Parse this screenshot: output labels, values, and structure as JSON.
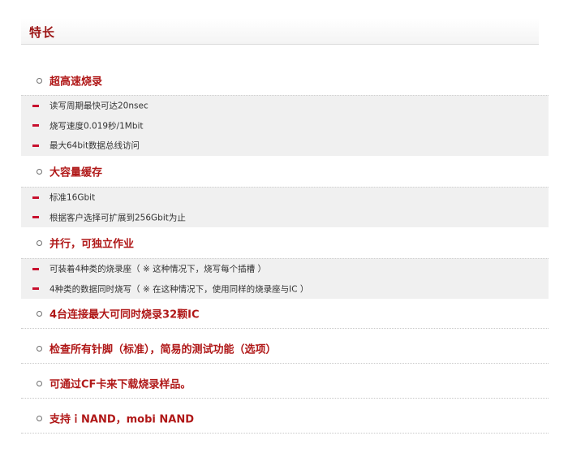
{
  "header": {
    "title": "特长"
  },
  "sections": [
    {
      "title": "超高速烧录",
      "items": [
        "读写周期最快可达20nsec",
        "烧写速度0.019秒/1Mbit",
        "最大64bit数据总线访问"
      ]
    },
    {
      "title": "大容量缓存",
      "items": [
        "标准16Gbit",
        "根据客户选择可扩展到256Gbit为止"
      ]
    },
    {
      "title": "并行，可独立作业",
      "items": [
        "可装着4种类的烧录座（ ※ 这种情况下，烧写每个插槽 ）",
        "4种类的数据同时烧写（ ※ 在这种情况下，使用同样的烧录座与IC ）"
      ]
    },
    {
      "title": "4台连接最大可同时烧录32颗IC",
      "items": []
    },
    {
      "title": "检查所有针脚（标准），简易的测试功能（选项）",
      "items": []
    },
    {
      "title": "可通过CF卡来下载烧录样品。",
      "items": []
    },
    {
      "title": "支持ｉNAND，mobi NAND",
      "items": []
    }
  ],
  "colors": {
    "accent": "#b01818",
    "dash": "#c8102e",
    "box": "#f0f0f0"
  }
}
